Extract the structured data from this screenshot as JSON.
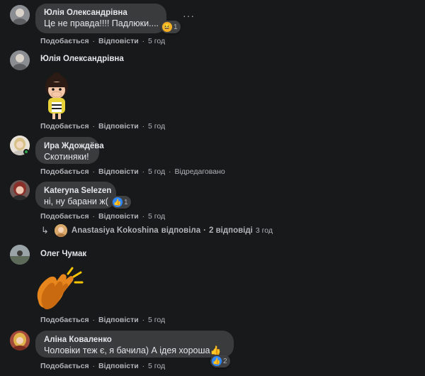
{
  "actions": {
    "like": "Подобається",
    "reply": "Відповісти",
    "sep": "·"
  },
  "comments": [
    {
      "author": "Юлія Олександрівна",
      "text": "Це не правда!!!! Падлюки....",
      "time": "5 год",
      "reaction_count": "1"
    },
    {
      "author": "Юлія Олександрівна",
      "sticker": "girl-covering-mouth-sticker",
      "time": "5 год"
    },
    {
      "author": "Ира Ждождёва",
      "text": "Скотиняки!",
      "time": "5 год",
      "edited": "Відредаговано"
    },
    {
      "author": "Kateryna Selezen",
      "text": "ні, ну барани ж(",
      "time": "5 год",
      "reaction_count": "1"
    },
    {
      "author": "Олег Чумак",
      "sticker": "clapping-hands-sticker",
      "time": "5 год"
    },
    {
      "author": "Аліна Коваленко",
      "text": "Чоловіки теж є, я бачила) А ідея хороша",
      "emoji": "👍",
      "time": "5 год",
      "reaction_count": "2"
    }
  ],
  "reply_thread": {
    "author": "Anastasiya Kokoshina",
    "verb": "відповіла",
    "count": "2 відповіді",
    "time": "3 год"
  },
  "more_label": "···",
  "colors": {
    "background": "#18191a",
    "bubble": "#3a3b3c",
    "like_blue": "#2d88ff",
    "online_green": "#31a24c"
  }
}
